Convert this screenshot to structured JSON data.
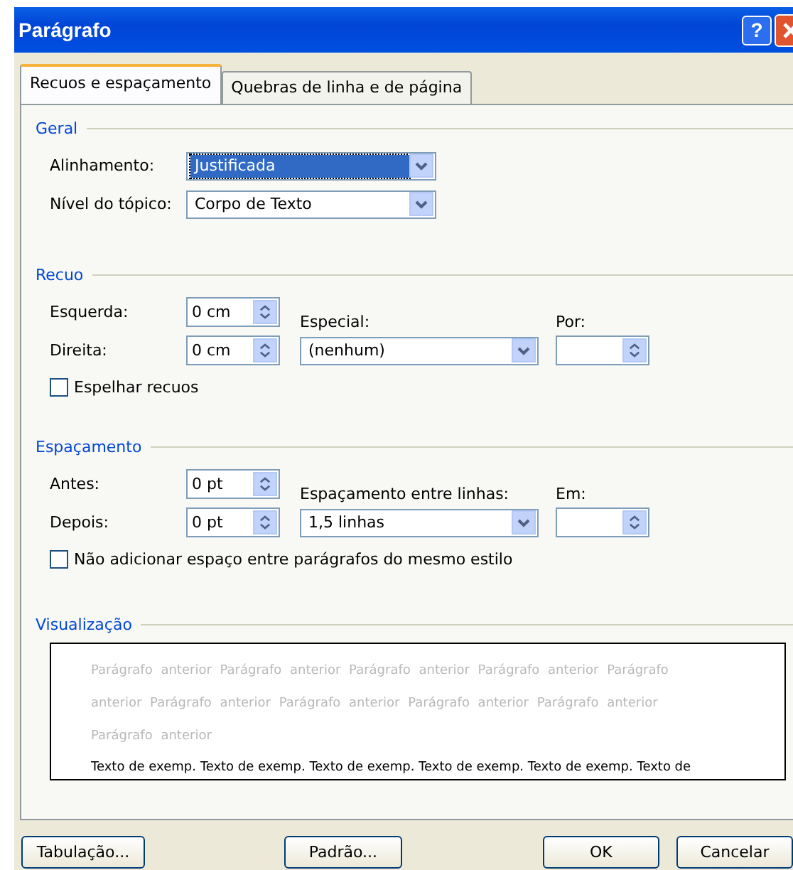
{
  "window": {
    "title": "Parágrafo"
  },
  "title_buttons": [
    {
      "kind": "help",
      "label": "?"
    },
    {
      "kind": "close"
    }
  ],
  "tabs": [
    {
      "label": "Recuos e espaçamento",
      "selected": true
    },
    {
      "label": "Quebras de linha e de página",
      "selected": false
    }
  ],
  "geral": {
    "title": "Geral",
    "alinhamento": {
      "label": "Alinhamento:",
      "value": "Justificada",
      "selected": true
    },
    "nivel": {
      "label": "Nível do tópico:",
      "value": "Corpo de Texto",
      "selected": false
    }
  },
  "recuo": {
    "title": "Recuo",
    "esquerda": {
      "label": "Esquerda:",
      "value": "0 cm"
    },
    "direita": {
      "label": "Direita:",
      "value": "0 cm"
    },
    "especial": {
      "label": "Especial:",
      "value": "(nenhum)"
    },
    "por": {
      "label": "Por:"
    },
    "espelhar": {
      "label": "Espelhar recuos",
      "checked": false
    }
  },
  "espacamento": {
    "title": "Espaçamento",
    "antes": {
      "label": "Antes:",
      "value": "0 pt"
    },
    "depois": {
      "label": "Depois:",
      "value": "0 pt"
    },
    "entre_linhas": {
      "label": "Espaçamento entre linhas:",
      "value": "1,5 linhas"
    },
    "em": {
      "label": "Em:"
    },
    "nao_adicionar": {
      "label": "Não adicionar espaço entre parágrafos do mesmo estilo",
      "checked": false
    }
  },
  "visualizacao": {
    "title": "Visualização",
    "previous_lines": [
      "Parágrafo anterior Parágrafo anterior Parágrafo anterior Parágrafo anterior Parágrafo",
      "anterior Parágrafo anterior Parágrafo anterior Parágrafo anterior Parágrafo anterior",
      "Parágrafo anterior"
    ],
    "sample_line": "Texto de exemp. Texto de exemp. Texto de exemp. Texto de exemp. Texto de exemp. Texto de"
  },
  "buttons": [
    {
      "label": "Tabulação...",
      "kind": "left"
    },
    {
      "label": "Padrão...",
      "kind": "middle"
    },
    {
      "label": "OK",
      "kind": "right"
    },
    {
      "label": "Cancelar",
      "kind": "right"
    }
  ]
}
